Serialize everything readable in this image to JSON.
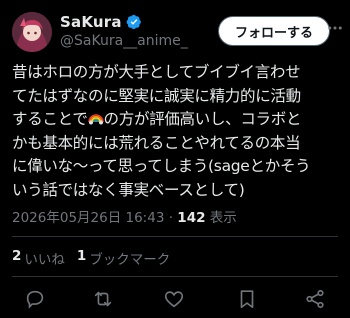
{
  "user": {
    "display_name": "SaKura",
    "handle": "@SaKura__anime_"
  },
  "follow_button_label": "フォローする",
  "tweet": {
    "line1": "昔はホロの方が大手としてブイブイ言わせ",
    "line2": "てたはずなのに堅実に誠実に精力的に活動",
    "line3a": "することで",
    "line3b": "の方が評価高いし、コラボと",
    "line4": "かも基本的には荒れることやれてるの本当",
    "line5": "に偉いな〜って思ってしまう(sageとかそう",
    "line6": "いう話ではなく事実ベースとして)"
  },
  "meta": {
    "timestamp": "2026年05月26日 16:43",
    "separator": " · ",
    "views_count": "142",
    "views_label": " 表示"
  },
  "stats": {
    "likes_count": "2",
    "likes_label": "いいね",
    "bookmarks_count": "1",
    "bookmarks_label": "ブックマーク"
  },
  "icons": {
    "verified": "verified-badge-icon",
    "more": "more-icon",
    "reply": "reply-icon",
    "retweet": "retweet-icon",
    "like": "heart-icon",
    "bookmark": "bookmark-icon",
    "share": "share-icon",
    "rainbow": "rainbow-emoji"
  },
  "colors": {
    "background": "#000000",
    "text": "#e7e9ea",
    "secondary": "#71767b",
    "verified": "#1d9bf0",
    "divider": "#2f3336"
  }
}
